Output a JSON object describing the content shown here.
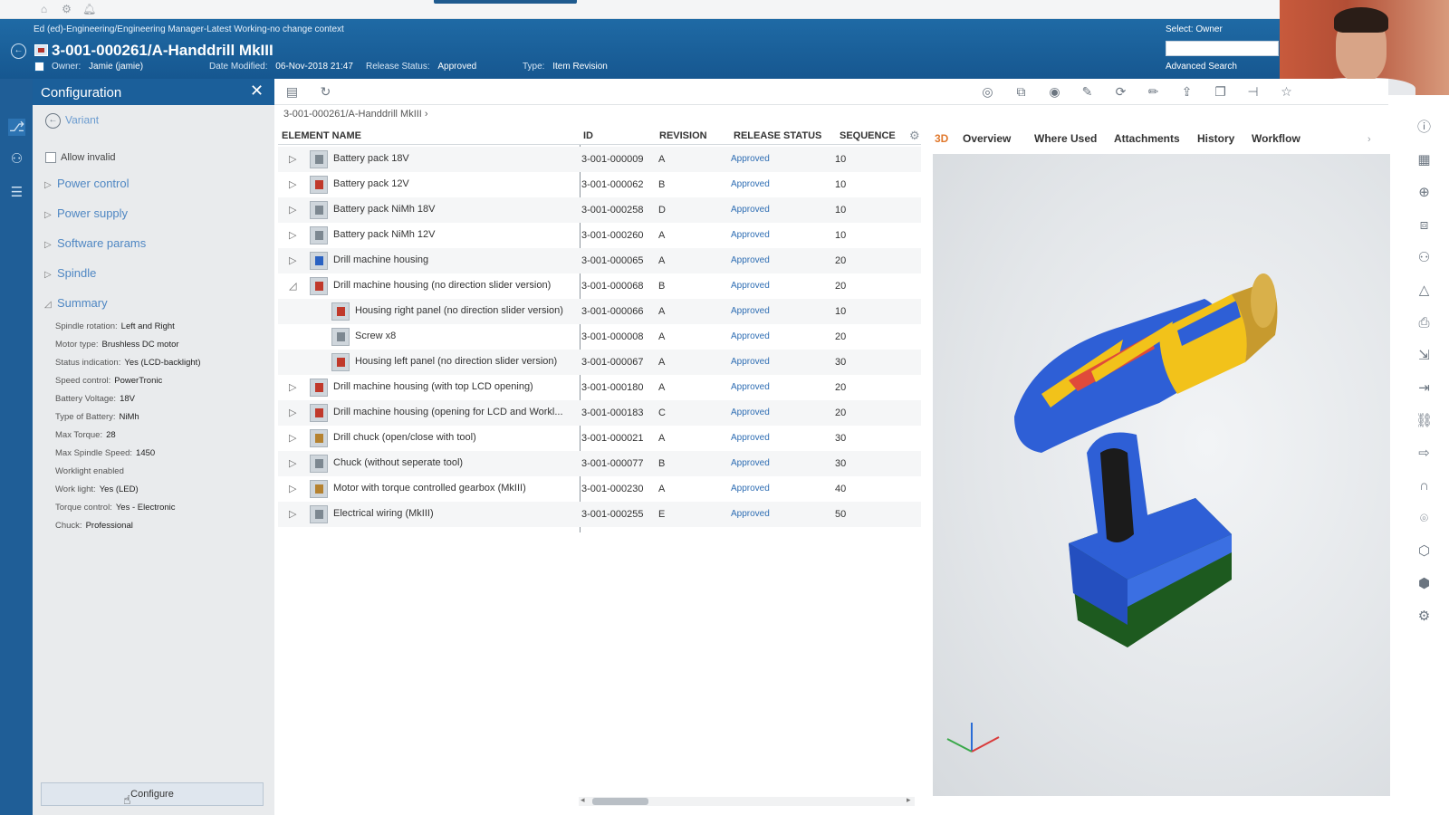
{
  "header": {
    "context": "Ed (ed)-Engineering/Engineering Manager-Latest Working-no change context",
    "title": "3-001-000261/A-Handdrill MkIII",
    "owner_label": "Owner:",
    "owner_value": "Jamie (jamie)",
    "date_label": "Date Modified:",
    "date_value": "06-Nov-2018 21:47",
    "release_label": "Release Status:",
    "release_value": "Approved",
    "type_label": "Type:",
    "type_value": "Item Revision",
    "select_owner": "Select: Owner",
    "search_value": "",
    "advanced_search": "Advanced Search"
  },
  "config": {
    "title": "Configuration",
    "variant_label": "Variant",
    "allow_invalid": "Allow invalid",
    "groups": [
      "Power control",
      "Power supply",
      "Software params",
      "Spindle",
      "Summary"
    ],
    "summary": [
      {
        "label": "Spindle rotation:",
        "value": "Left and Right"
      },
      {
        "label": "Motor type:",
        "value": "Brushless DC motor"
      },
      {
        "label": "Status indication:",
        "value": "Yes (LCD-backlight)"
      },
      {
        "label": "Speed control:",
        "value": "PowerTronic"
      },
      {
        "label": "Battery Voltage:",
        "value": "18V"
      },
      {
        "label": "Type of Battery:",
        "value": "NiMh"
      },
      {
        "label": "Max Torque:",
        "value": "28"
      },
      {
        "label": "Max Spindle Speed:",
        "value": "1450"
      },
      {
        "label": "Worklight enabled",
        "value": ""
      },
      {
        "label": "Work light:",
        "value": "Yes (LED)"
      },
      {
        "label": "Torque control:",
        "value": "Yes - Electronic"
      },
      {
        "label": "Chuck:",
        "value": "Professional"
      }
    ],
    "configure_button": "Configure"
  },
  "breadcrumb": "3-001-000261/A-Handdrill MkIII",
  "table": {
    "columns": [
      "ELEMENT NAME",
      "ID",
      "REVISION",
      "RELEASE STATUS",
      "SEQUENCE"
    ],
    "rows": [
      {
        "name": "Battery pack 18V",
        "id": "3-001-000009",
        "rev": "A",
        "status": "Approved",
        "seq": "10",
        "level": 0,
        "expander": "collapsed"
      },
      {
        "name": "Battery pack 12V",
        "id": "3-001-000062",
        "rev": "B",
        "status": "Approved",
        "seq": "10",
        "level": 0,
        "expander": "collapsed"
      },
      {
        "name": "Battery pack NiMh 18V",
        "id": "3-001-000258",
        "rev": "D",
        "status": "Approved",
        "seq": "10",
        "level": 0,
        "expander": "collapsed"
      },
      {
        "name": "Battery pack NiMh 12V",
        "id": "3-001-000260",
        "rev": "A",
        "status": "Approved",
        "seq": "10",
        "level": 0,
        "expander": "collapsed"
      },
      {
        "name": "Drill machine housing",
        "id": "3-001-000065",
        "rev": "A",
        "status": "Approved",
        "seq": "20",
        "level": 0,
        "expander": "collapsed"
      },
      {
        "name": "Drill machine housing (no direction slider version)",
        "id": "3-001-000068",
        "rev": "B",
        "status": "Approved",
        "seq": "20",
        "level": 0,
        "expander": "expanded"
      },
      {
        "name": "Housing right panel (no direction slider version)",
        "id": "3-001-000066",
        "rev": "A",
        "status": "Approved",
        "seq": "10",
        "level": 1,
        "expander": "none"
      },
      {
        "name": "Screw x8",
        "id": "3-001-000008",
        "rev": "A",
        "status": "Approved",
        "seq": "20",
        "level": 1,
        "expander": "none"
      },
      {
        "name": "Housing left panel (no direction slider version)",
        "id": "3-001-000067",
        "rev": "A",
        "status": "Approved",
        "seq": "30",
        "level": 1,
        "expander": "none"
      },
      {
        "name": "Drill machine housing (with top LCD opening)",
        "id": "3-001-000180",
        "rev": "A",
        "status": "Approved",
        "seq": "20",
        "level": 0,
        "expander": "collapsed"
      },
      {
        "name": "Drill machine housing (opening for LCD and Workl...",
        "id": "3-001-000183",
        "rev": "C",
        "status": "Approved",
        "seq": "20",
        "level": 0,
        "expander": "collapsed"
      },
      {
        "name": "Drill chuck (open/close with tool)",
        "id": "3-001-000021",
        "rev": "A",
        "status": "Approved",
        "seq": "30",
        "level": 0,
        "expander": "collapsed"
      },
      {
        "name": "Chuck (without seperate tool)",
        "id": "3-001-000077",
        "rev": "B",
        "status": "Approved",
        "seq": "30",
        "level": 0,
        "expander": "collapsed"
      },
      {
        "name": "Motor with torque controlled gearbox (MkIII)",
        "id": "3-001-000230",
        "rev": "A",
        "status": "Approved",
        "seq": "40",
        "level": 0,
        "expander": "collapsed"
      },
      {
        "name": "Electrical wiring (MkIII)",
        "id": "3-001-000255",
        "rev": "E",
        "status": "Approved",
        "seq": "50",
        "level": 0,
        "expander": "collapsed"
      }
    ]
  },
  "viewer_tabs": [
    "3D",
    "Overview",
    "Where Used",
    "Attachments",
    "History",
    "Workflow"
  ],
  "colors": {
    "header_blue": "#1f6aa5",
    "rail_blue": "#1f5e97",
    "link_blue": "#2e6db3",
    "active_tab": "#e0782c",
    "drill_blue": "#2e5fd6",
    "drill_yellow": "#f2c21a",
    "battery_green": "#1d5a1f"
  }
}
